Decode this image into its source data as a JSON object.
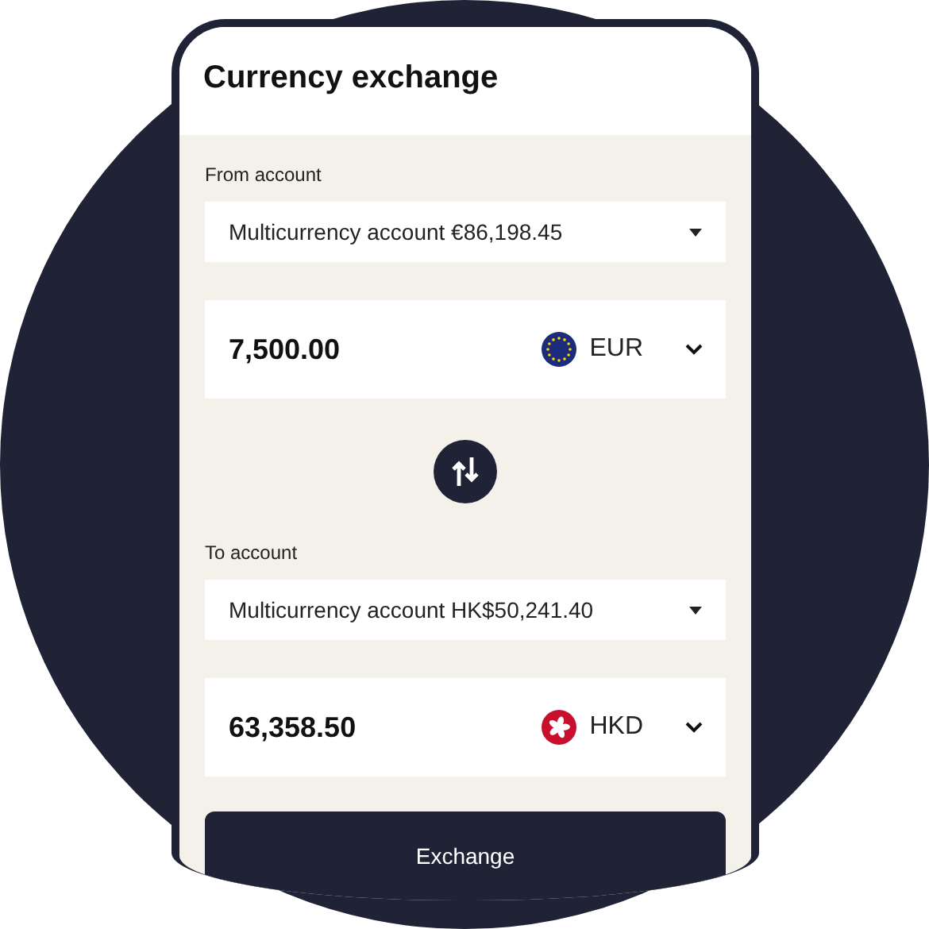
{
  "title": "Currency exchange",
  "from": {
    "label": "From account",
    "account": "Multicurrency account €86,198.45",
    "amount": "7,500.00",
    "currency": "EUR",
    "kind": "eu"
  },
  "to": {
    "label": "To account",
    "account": "Multicurrency account HK$50,241.40",
    "amount": "63,358.50",
    "currency": "HKD",
    "kind": "hk"
  },
  "button": "Exchange"
}
